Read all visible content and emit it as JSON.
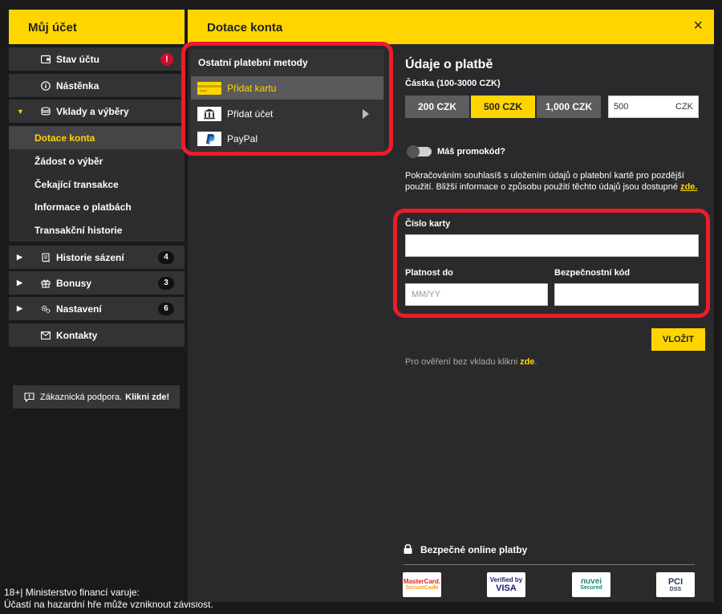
{
  "sidebar": {
    "title": "Můj účet",
    "items": [
      {
        "label": "Stav účtu",
        "icon": "wallet-icon",
        "alert": "!"
      },
      {
        "label": "Nástěnka",
        "icon": "info-icon"
      },
      {
        "label": "Vklady a výběry",
        "icon": "coins-icon"
      },
      {
        "label": "Historie sázení",
        "icon": "receipt-icon",
        "badge": "4"
      },
      {
        "label": "Bonusy",
        "icon": "gift-icon",
        "badge": "3"
      },
      {
        "label": "Nastavení",
        "icon": "gears-icon",
        "badge": "6"
      },
      {
        "label": "Kontakty",
        "icon": "mail-icon"
      }
    ],
    "sub_items": [
      {
        "label": "Dotace konta"
      },
      {
        "label": "Žádost o výběr"
      },
      {
        "label": "Čekající transakce"
      },
      {
        "label": "Informace o platbách"
      },
      {
        "label": "Transakční historie"
      }
    ],
    "support_text": "Zákaznická podpora.",
    "support_link": "Klikni zde!"
  },
  "warning": {
    "line1": "18+| Ministerstvo financí varuje:",
    "line2": "Účastí na hazardní hře může vzniknout závislost."
  },
  "main": {
    "title": "Dotace konta",
    "close_label": "×",
    "methods_title": "Ostatní platební metody",
    "methods": [
      {
        "label": "Přidat kartu",
        "icon": "card-icon"
      },
      {
        "label": "Přidat účet",
        "icon": "bank-icon"
      },
      {
        "label": "PayPal",
        "icon": "paypal-icon"
      }
    ],
    "payment_title": "Údaje o platbě",
    "amount_label": "Částka (100-3000 CZK)",
    "amount_options": [
      "200 CZK",
      "500 CZK",
      "1,000 CZK"
    ],
    "amount_value": "500",
    "currency": "CZK",
    "promo_label": "Máš promokód?",
    "consent_text": "Pokračováním souhlasíš s uložením údajů o platební kartě pro pozdější použití. Bližší informace o způsobu použití těchto údajů jsou dostupné",
    "consent_link": "zde.",
    "card_number_label": "Číslo karty",
    "expiry_label": "Platnost do",
    "expiry_placeholder": "MM/YY",
    "cvv_label": "Bezpečnostní kód",
    "submit_label": "VLOŽIT",
    "verify_text": "Pro ověření bez vkladu klikni",
    "verify_link": "zde",
    "verify_end": ".",
    "secure_label": "Bezpečné online platby",
    "logos": [
      {
        "l1": "MasterCard.",
        "l2": "SecureCode",
        "color": "#e2231a"
      },
      {
        "l1": "Verified by",
        "l2": "VISA",
        "color": "#1a1f71"
      },
      {
        "l1": "nuvei",
        "l2": "Secured",
        "color": "#1a8a7a"
      },
      {
        "l1": "PCI",
        "l2": "DSS",
        "color": "#2a3b5a"
      }
    ]
  },
  "colors": {
    "accent": "#ffd500",
    "highlight": "#ee1c2b",
    "panel": "#2a2a2c"
  }
}
